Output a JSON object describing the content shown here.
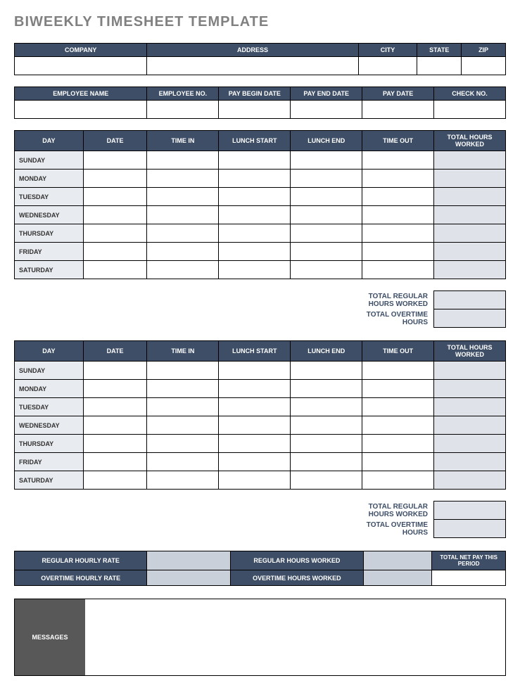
{
  "title": "BIWEEKLY TIMESHEET TEMPLATE",
  "company_headers": {
    "company": "COMPANY",
    "address": "ADDRESS",
    "city": "CITY",
    "state": "STATE",
    "zip": "ZIP"
  },
  "employee_headers": {
    "name": "EMPLOYEE NAME",
    "no": "EMPLOYEE NO.",
    "pay_begin": "PAY BEGIN DATE",
    "pay_end": "PAY END DATE",
    "pay_date": "PAY DATE",
    "check_no": "CHECK NO."
  },
  "week_headers": {
    "day": "DAY",
    "date": "DATE",
    "time_in": "TIME IN",
    "lunch_start": "LUNCH START",
    "lunch_end": "LUNCH END",
    "time_out": "TIME OUT",
    "total": "TOTAL HOURS WORKED"
  },
  "days": [
    "SUNDAY",
    "MONDAY",
    "TUESDAY",
    "WEDNESDAY",
    "THURSDAY",
    "FRIDAY",
    "SATURDAY"
  ],
  "totals": {
    "regular": "TOTAL REGULAR HOURS WORKED",
    "overtime": "TOTAL OVERTIME HOURS"
  },
  "rates": {
    "reg_rate": "REGULAR HOURLY RATE",
    "reg_hours": "REGULAR HOURS WORKED",
    "ot_rate": "OVERTIME HOURLY RATE",
    "ot_hours": "OVERTIME HOURS WORKED",
    "net": "TOTAL NET PAY THIS PERIOD"
  },
  "messages_label": "MESSAGES"
}
